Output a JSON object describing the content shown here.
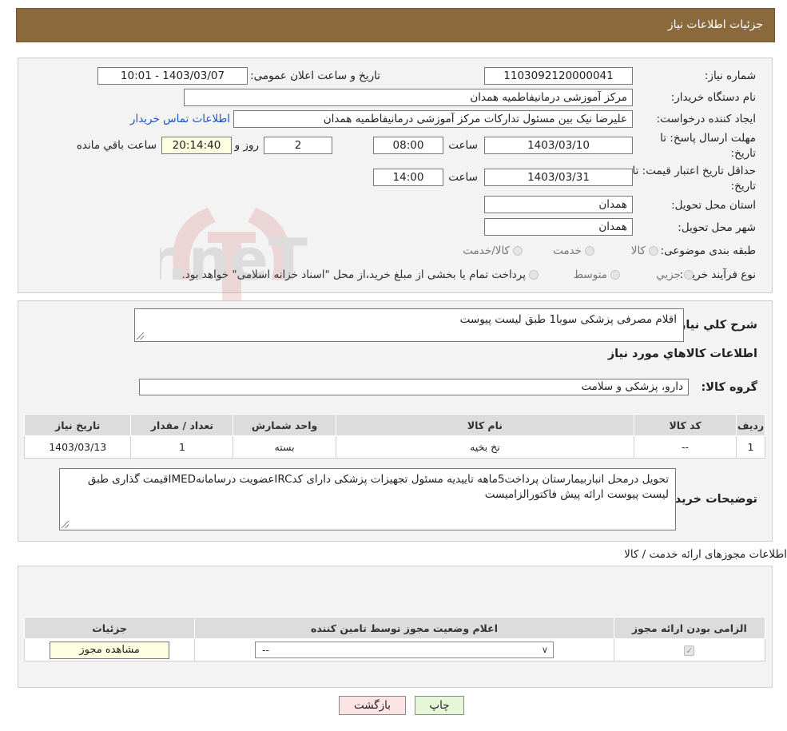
{
  "header": {
    "title": "جزئیات اطلاعات نیاز"
  },
  "need": {
    "need_number_label": "شماره نیاز:",
    "need_number": "1103092120000041",
    "announce_label": "تاریخ و ساعت اعلان عمومی:",
    "announce_value": "1403/03/07 - 10:01",
    "buyer_org_label": "نام دستگاه خریدار:",
    "buyer_org": "مرکز آموزشی درمانیفاطمیه همدان",
    "creator_label": "ایجاد کننده درخواست:",
    "creator": "علیرضا نیک بین مسئول تدارکات مرکز آموزشی درمانیفاطمیه همدان",
    "contact_link": "اطلاعات تماس خریدار",
    "deadline_label_1": "مهلت ارسال پاسخ: تا",
    "deadline_label_2": "تاریخ:",
    "deadline_date": "1403/03/10",
    "time_label": "ساعت",
    "deadline_time": "08:00",
    "days": "2",
    "days_label": "روز و",
    "remaining_time": "20:14:40",
    "remaining_label": "ساعت باقي مانده",
    "validity_label_1": "حداقل تاریخ اعتبار قیمت: تا",
    "validity_label_2": "تاریخ:",
    "validity_date": "1403/03/31",
    "validity_time": "14:00",
    "province_label": "استان محل تحویل:",
    "province": "همدان",
    "city_label": "شهر محل تحویل:",
    "city": "همدان",
    "category_label": "طبقه بندی موضوعی:",
    "category_options": [
      "کالا",
      "خدمت",
      "کالا/خدمت"
    ],
    "process_label": "نوع فرآیند خرید :",
    "process_options": [
      "جزيي",
      "متوسط"
    ],
    "process_note": "پرداخت تمام یا بخشی از مبلغ خرید،از محل \"اسناد خزانه اسلامی\" خواهد بود."
  },
  "description": {
    "label": "شرح كلي نياز:",
    "value": "اقلام مصرفی پزشکی سوبا1 طبق لیست پیوست",
    "goods_info_title": "اطلاعات كالاهاي مورد نياز",
    "group_label": "گروه كالا:",
    "group_value": "دارو، پزشکی و سلامت"
  },
  "goods_table": {
    "headers": [
      "رديف",
      "كد كالا",
      "نام كالا",
      "واحد شمارش",
      "تعداد / مقدار",
      "تاريخ نياز"
    ],
    "rows": [
      [
        "1",
        "--",
        "نخ بخیه",
        "بسته",
        "1",
        "1403/03/13"
      ]
    ]
  },
  "buyer_notes": {
    "label": "توضیحات خریدار:",
    "value": "تحویل درمحل انباربیمارستان پرداخت5ماهه تاییدیه مسئول تجهیزات پزشکی دارای کدIRCعضویت درسامانهIMEDقیمت گذاری طبق لیست پیوست ارائه پیش فاکتورالزامیست"
  },
  "permits": {
    "title": "اطلاعات مجوزهای ارائه خدمت / کالا",
    "headers": [
      "الزامی بودن ارائه مجوز",
      "اعلام وضعیت مجوز توسط تامین کننده",
      "جزئیات"
    ],
    "select_value": "--",
    "view_button": "مشاهده مجوز"
  },
  "buttons": {
    "print": "چاپ",
    "back": "بازگشت"
  },
  "watermark": {
    "text": "AriaTender.neT"
  },
  "colors": {
    "header_bg": "#8a6a3d",
    "link": "#1a55c4",
    "print_btn": "#e6f7d8",
    "back_btn": "#fde4e4"
  }
}
